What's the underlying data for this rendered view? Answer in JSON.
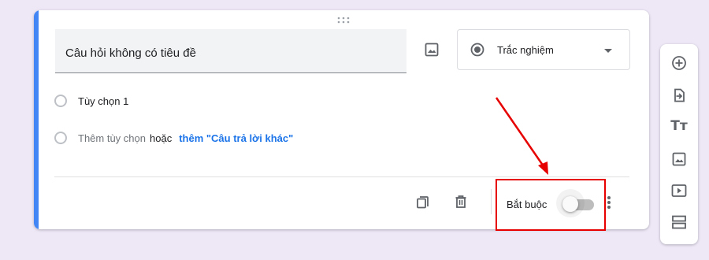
{
  "question": {
    "title": "Câu hỏi không có tiêu đề",
    "type_label": "Trắc nghiệm"
  },
  "options": {
    "option1": "Tùy chọn 1",
    "add_option": "Thêm tùy chọn",
    "or_text": "hoặc",
    "add_other": "thêm \"Câu trả lời khác\""
  },
  "footer": {
    "required_label": "Bắt buộc",
    "required_on": false
  },
  "toolbar": {
    "title_icon_text": "Tт"
  },
  "icons": {
    "drag": "drag-handle-icon",
    "image": "image-icon",
    "radio": "radio-button-icon",
    "dropdown": "chevron-down-icon",
    "duplicate": "copy-icon",
    "delete": "trash-icon",
    "more": "more-vert-icon",
    "add_question": "add-circle-icon",
    "import": "import-icon",
    "title": "title-icon",
    "add_image": "image-icon",
    "add_video": "video-icon",
    "section": "section-icon"
  },
  "colors": {
    "background": "#ede7f6",
    "accent": "#4285f4",
    "link": "#1a73e8",
    "annotation": "#e60000"
  }
}
